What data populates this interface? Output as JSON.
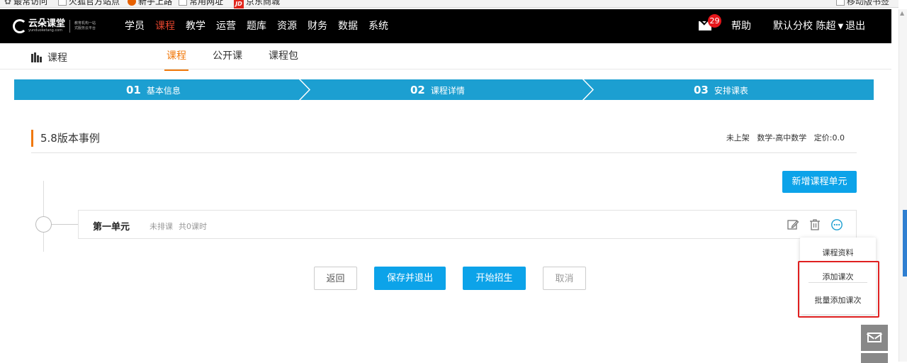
{
  "bookmarks": {
    "items": [
      "最常访问",
      "火狐官方站点",
      "新手上路",
      "常用网址",
      "京东商城"
    ],
    "right": "移动版书签"
  },
  "topnav": {
    "logo_text": "云朵课堂",
    "logo_sub": "yunduoketang.com",
    "logo_slogan_1": "教育机构一站",
    "logo_slogan_2": "式服务云平台",
    "menu": [
      "学员",
      "课程",
      "教学",
      "运营",
      "题库",
      "资源",
      "财务",
      "数据",
      "系统"
    ],
    "active_menu": "课程",
    "mail_badge": "29",
    "help": "帮助",
    "school": "默认分校",
    "user": "陈超",
    "logout": "退出"
  },
  "subnav": {
    "title": "课程",
    "tabs": [
      "课程",
      "公开课",
      "课程包"
    ],
    "active_tab": "课程"
  },
  "steps": [
    {
      "num": "01",
      "label": "基本信息"
    },
    {
      "num": "02",
      "label": "课程详情"
    },
    {
      "num": "03",
      "label": "安排课表"
    }
  ],
  "course": {
    "title": "5.8版本事例",
    "status": "未上架",
    "category": "数学-高中数学",
    "price": "定价:0.0"
  },
  "actions": {
    "add_unit": "新增课程单元",
    "back": "返回",
    "save_exit": "保存并退出",
    "start_enroll": "开始招生",
    "cancel": "取消"
  },
  "unit": {
    "name": "第一单元",
    "schedule_status": "未排课",
    "count": "共0课时"
  },
  "dropdown": {
    "items": [
      "课程资料",
      "添加课次",
      "批量添加课次"
    ]
  },
  "colors": {
    "nav_bg": "#000000",
    "active_red": "#e6452e",
    "tab_orange": "#f0780b",
    "step_blue": "#1c9fd1",
    "button_blue": "#0ca3e9",
    "highlight_red": "#e02020"
  }
}
